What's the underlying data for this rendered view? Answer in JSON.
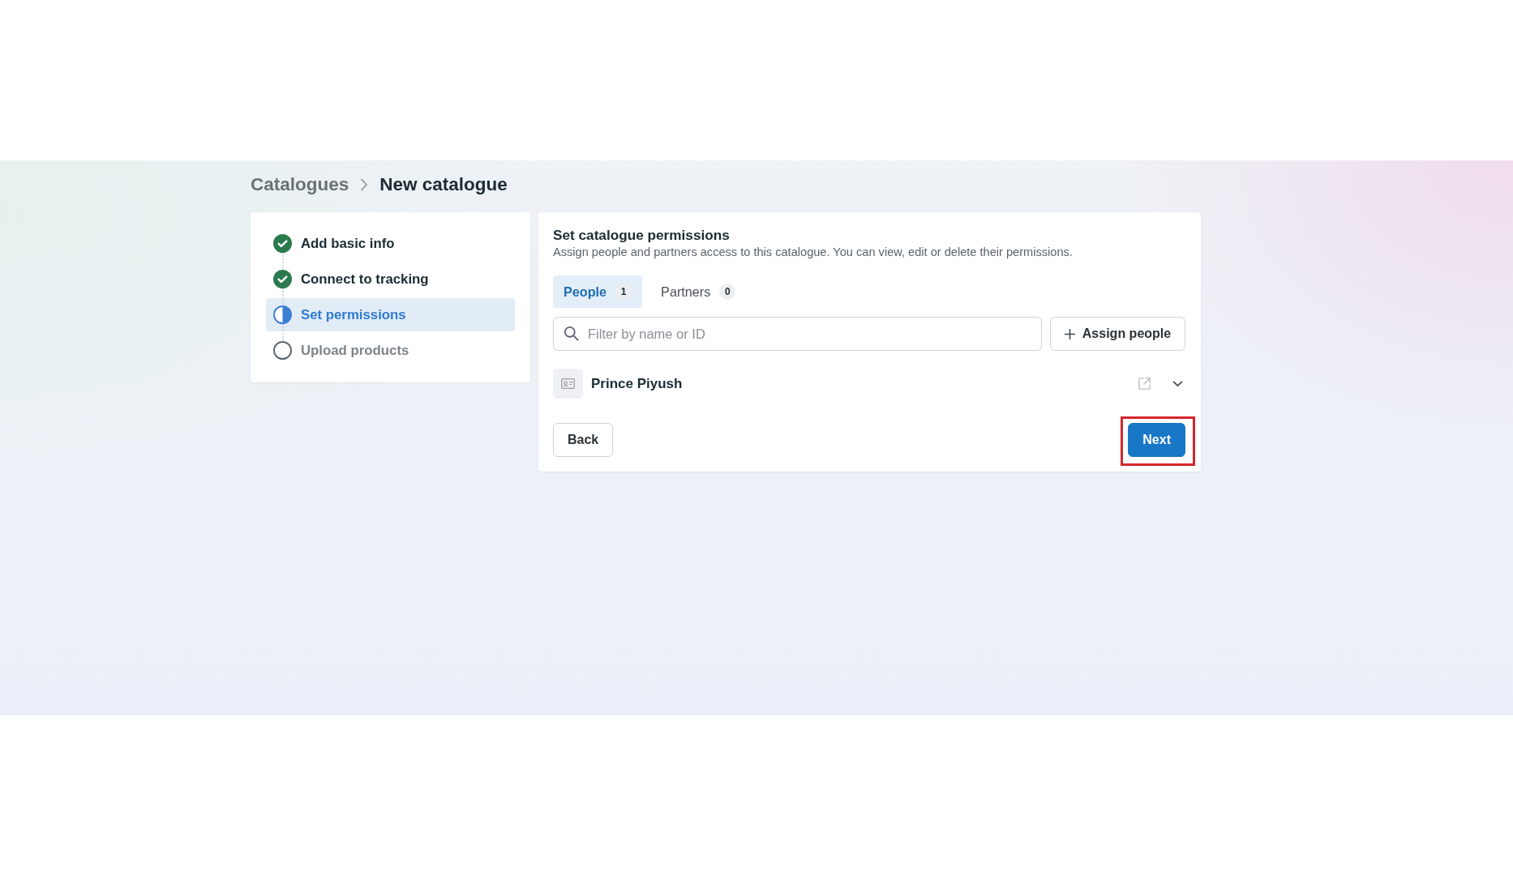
{
  "breadcrumb": [
    {
      "label": "Catalogues",
      "current": false
    },
    {
      "label": "New catalogue",
      "current": true
    }
  ],
  "steps": [
    {
      "label": "Add basic info",
      "completed": true,
      "selected": false
    },
    {
      "label": "Connect to tracking",
      "completed": true,
      "selected": false
    },
    {
      "label": "Set permissions",
      "completed": false,
      "selected": true
    },
    {
      "label": "Upload products",
      "completed": false,
      "selected": false
    }
  ],
  "permissions": {
    "title": "Set catalogue permissions",
    "description": "Assign people and partners access to this catalogue. You can view, edit or delete their permissions.",
    "tabs": [
      {
        "label": "People",
        "count": "1",
        "selected": true
      },
      {
        "label": "Partners",
        "count": "0",
        "selected": false
      }
    ],
    "search": {
      "placeholder": "Filter by name or ID"
    },
    "assign_button": {
      "label": "Assign people"
    },
    "people": [
      {
        "name": "Prince Piyush"
      }
    ]
  },
  "actions": [
    {
      "label": "Back",
      "kind": "secondary",
      "highlighted": false
    },
    {
      "label": "Next",
      "kind": "primary",
      "highlighted": true
    }
  ]
}
